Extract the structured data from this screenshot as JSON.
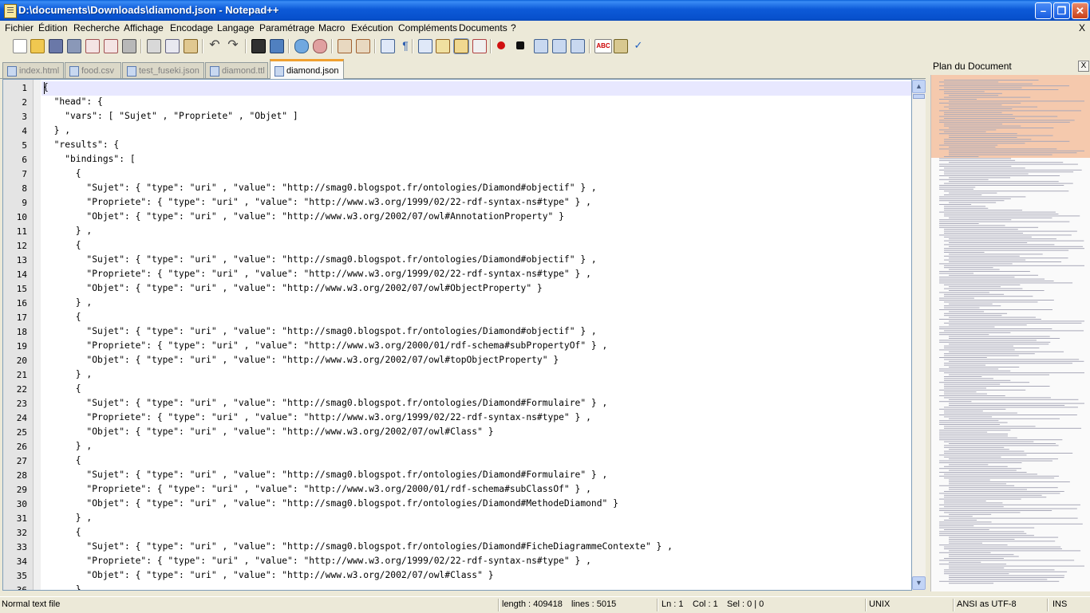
{
  "window": {
    "title": "D:\\documents\\Downloads\\diamond.json - Notepad++"
  },
  "menu": [
    "Fichier",
    "Édition",
    "Recherche",
    "Affichage",
    "Encodage",
    "Langage",
    "Paramétrage",
    "Macro",
    "Exécution",
    "Compléments",
    "Documents",
    "?"
  ],
  "menu_close": "X",
  "tabs": [
    {
      "label": "index.html",
      "active": false
    },
    {
      "label": "food.csv",
      "active": false
    },
    {
      "label": "test_fuseki.json",
      "active": false
    },
    {
      "label": "diamond.ttl",
      "active": false
    },
    {
      "label": "diamond.json",
      "active": true
    }
  ],
  "toolbar_icons": [
    "new-file-icon",
    "open-file-icon",
    "save-icon",
    "save-all-icon",
    "close-icon",
    "close-all-icon",
    "print-icon",
    "cut-icon",
    "copy-icon",
    "paste-icon",
    "undo-icon",
    "redo-icon",
    "find-icon",
    "replace-icon",
    "zoom-in-icon",
    "zoom-out-icon",
    "sync-vertical-icon",
    "sync-horizontal-icon",
    "word-wrap-icon",
    "show-all-chars-icon",
    "indent-guide-icon",
    "user-lang-icon",
    "doc-map-icon",
    "function-list-icon",
    "record-macro-icon",
    "stop-macro-icon",
    "play-macro-icon",
    "run-macro-multiple-icon",
    "save-macro-icon",
    "spellcheck-icon",
    "spellcheck-options-icon",
    "spellcheck-auto-icon"
  ],
  "editor": {
    "lines": [
      "{",
      "  \"head\": {",
      "    \"vars\": [ \"Sujet\" , \"Propriete\" , \"Objet\" ]",
      "  } ,",
      "  \"results\": {",
      "    \"bindings\": [",
      "      {",
      "        \"Sujet\": { \"type\": \"uri\" , \"value\": \"http://smag0.blogspot.fr/ontologies/Diamond#objectif\" } ,",
      "        \"Propriete\": { \"type\": \"uri\" , \"value\": \"http://www.w3.org/1999/02/22-rdf-syntax-ns#type\" } ,",
      "        \"Objet\": { \"type\": \"uri\" , \"value\": \"http://www.w3.org/2002/07/owl#AnnotationProperty\" }",
      "      } ,",
      "      {",
      "        \"Sujet\": { \"type\": \"uri\" , \"value\": \"http://smag0.blogspot.fr/ontologies/Diamond#objectif\" } ,",
      "        \"Propriete\": { \"type\": \"uri\" , \"value\": \"http://www.w3.org/1999/02/22-rdf-syntax-ns#type\" } ,",
      "        \"Objet\": { \"type\": \"uri\" , \"value\": \"http://www.w3.org/2002/07/owl#ObjectProperty\" }",
      "      } ,",
      "      {",
      "        \"Sujet\": { \"type\": \"uri\" , \"value\": \"http://smag0.blogspot.fr/ontologies/Diamond#objectif\" } ,",
      "        \"Propriete\": { \"type\": \"uri\" , \"value\": \"http://www.w3.org/2000/01/rdf-schema#subPropertyOf\" } ,",
      "        \"Objet\": { \"type\": \"uri\" , \"value\": \"http://www.w3.org/2002/07/owl#topObjectProperty\" }",
      "      } ,",
      "      {",
      "        \"Sujet\": { \"type\": \"uri\" , \"value\": \"http://smag0.blogspot.fr/ontologies/Diamond#Formulaire\" } ,",
      "        \"Propriete\": { \"type\": \"uri\" , \"value\": \"http://www.w3.org/1999/02/22-rdf-syntax-ns#type\" } ,",
      "        \"Objet\": { \"type\": \"uri\" , \"value\": \"http://www.w3.org/2002/07/owl#Class\" }",
      "      } ,",
      "      {",
      "        \"Sujet\": { \"type\": \"uri\" , \"value\": \"http://smag0.blogspot.fr/ontologies/Diamond#Formulaire\" } ,",
      "        \"Propriete\": { \"type\": \"uri\" , \"value\": \"http://www.w3.org/2000/01/rdf-schema#subClassOf\" } ,",
      "        \"Objet\": { \"type\": \"uri\" , \"value\": \"http://smag0.blogspot.fr/ontologies/Diamond#MethodeDiamond\" }",
      "      } ,",
      "      {",
      "        \"Sujet\": { \"type\": \"uri\" , \"value\": \"http://smag0.blogspot.fr/ontologies/Diamond#FicheDiagrammeContexte\" } ,",
      "        \"Propriete\": { \"type\": \"uri\" , \"value\": \"http://www.w3.org/1999/02/22-rdf-syntax-ns#type\" } ,",
      "        \"Objet\": { \"type\": \"uri\" , \"value\": \"http://www.w3.org/2002/07/owl#Class\" }",
      "      } ,"
    ],
    "current_line": 1
  },
  "docmap": {
    "title": "Plan du Document",
    "close": "X"
  },
  "status": {
    "file_type": "Normal text file",
    "length": "length : 409418",
    "lines": "lines : 5015",
    "ln": "Ln : 1",
    "col": "Col : 1",
    "sel": "Sel : 0 | 0",
    "eol": "UNIX",
    "encoding": "ANSI as UTF-8",
    "mode": "INS"
  },
  "colors": {
    "titlebar": "#0a5fd8",
    "current_line": "#e8e8ff",
    "docmap_viewport": "#f0a06e",
    "toolbar_bg": "#ece9d8"
  }
}
